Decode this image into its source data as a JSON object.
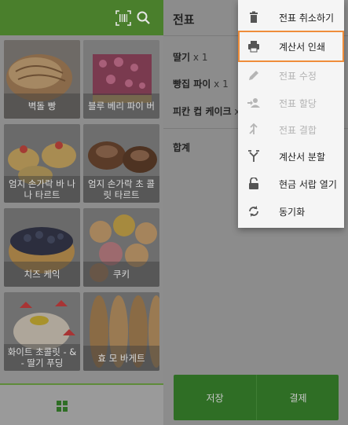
{
  "left_panel": {
    "top_bar_color": "#4a7f2c",
    "icons": [
      "barcode-icon",
      "search-icon"
    ],
    "products": [
      {
        "name": "벽돌 빵"
      },
      {
        "name": "블루 베리 파이 버"
      },
      {
        "name": "엄지 손가락 바 나나 타르트"
      },
      {
        "name": "엄지 손가락 초 콜릿 타르트"
      },
      {
        "name": "치즈 케익"
      },
      {
        "name": "쿠키"
      },
      {
        "name": "화이트 초콜릿 - & - 딸기 푸딩"
      },
      {
        "name": "효 모 바게트"
      }
    ],
    "bottom_nav_icon": "grid-icon"
  },
  "ticket": {
    "title": "전표",
    "items": [
      {
        "name": "딸기",
        "qty": " x 1"
      },
      {
        "name": "빵집 파이",
        "qty": " x 1"
      },
      {
        "name": "피칸 컵 케이크",
        "qty": " x"
      }
    ],
    "total_label": "합계",
    "save_label": "저장",
    "pay_label": "결제"
  },
  "menu": {
    "items": [
      {
        "label": "전표 취소하기",
        "icon": "trash-icon",
        "disabled": false,
        "selected": false
      },
      {
        "label": "계산서 인쇄",
        "icon": "printer-icon",
        "disabled": false,
        "selected": true
      },
      {
        "label": "전표 수정",
        "icon": "pencil-icon",
        "disabled": true,
        "selected": false
      },
      {
        "label": "전표 할당",
        "icon": "assign-person-icon",
        "disabled": true,
        "selected": false
      },
      {
        "label": "전표 결합",
        "icon": "merge-icon",
        "disabled": true,
        "selected": false
      },
      {
        "label": "계산서 분할",
        "icon": "split-icon",
        "disabled": false,
        "selected": false
      },
      {
        "label": "현금 서랍 열기",
        "icon": "unlock-icon",
        "disabled": false,
        "selected": false
      },
      {
        "label": "동기화",
        "icon": "sync-icon",
        "disabled": false,
        "selected": false
      }
    ]
  },
  "colors": {
    "accent_green": "#4a7f2c",
    "selected_outline": "#ef8d3a"
  }
}
